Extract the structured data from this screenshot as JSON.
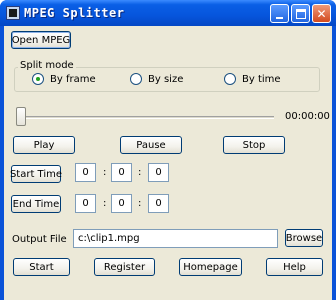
{
  "window": {
    "title": "MPEG Splitter"
  },
  "toolbar": {
    "open_label": "Open MPEG"
  },
  "split_mode": {
    "label": "Split mode",
    "options": [
      {
        "label": "By frame",
        "checked": true
      },
      {
        "label": "By size",
        "checked": false
      },
      {
        "label": "By time",
        "checked": false
      }
    ]
  },
  "playback": {
    "position_fraction": 0.0,
    "time_display": "00:00:00",
    "play_label": "Play",
    "pause_label": "Pause",
    "stop_label": "Stop"
  },
  "start_time": {
    "button_label": "Start Time",
    "hours": "0",
    "minutes": "0",
    "seconds": "0"
  },
  "end_time": {
    "button_label": "End Time",
    "hours": "0",
    "minutes": "0",
    "seconds": "0"
  },
  "separator": ":",
  "output": {
    "label": "Output File",
    "value": "c:\\clip1.mpg",
    "browse_label": "Browse"
  },
  "actions": {
    "start_label": "Start",
    "register_label": "Register",
    "homepage_label": "Homepage",
    "help_label": "Help"
  }
}
